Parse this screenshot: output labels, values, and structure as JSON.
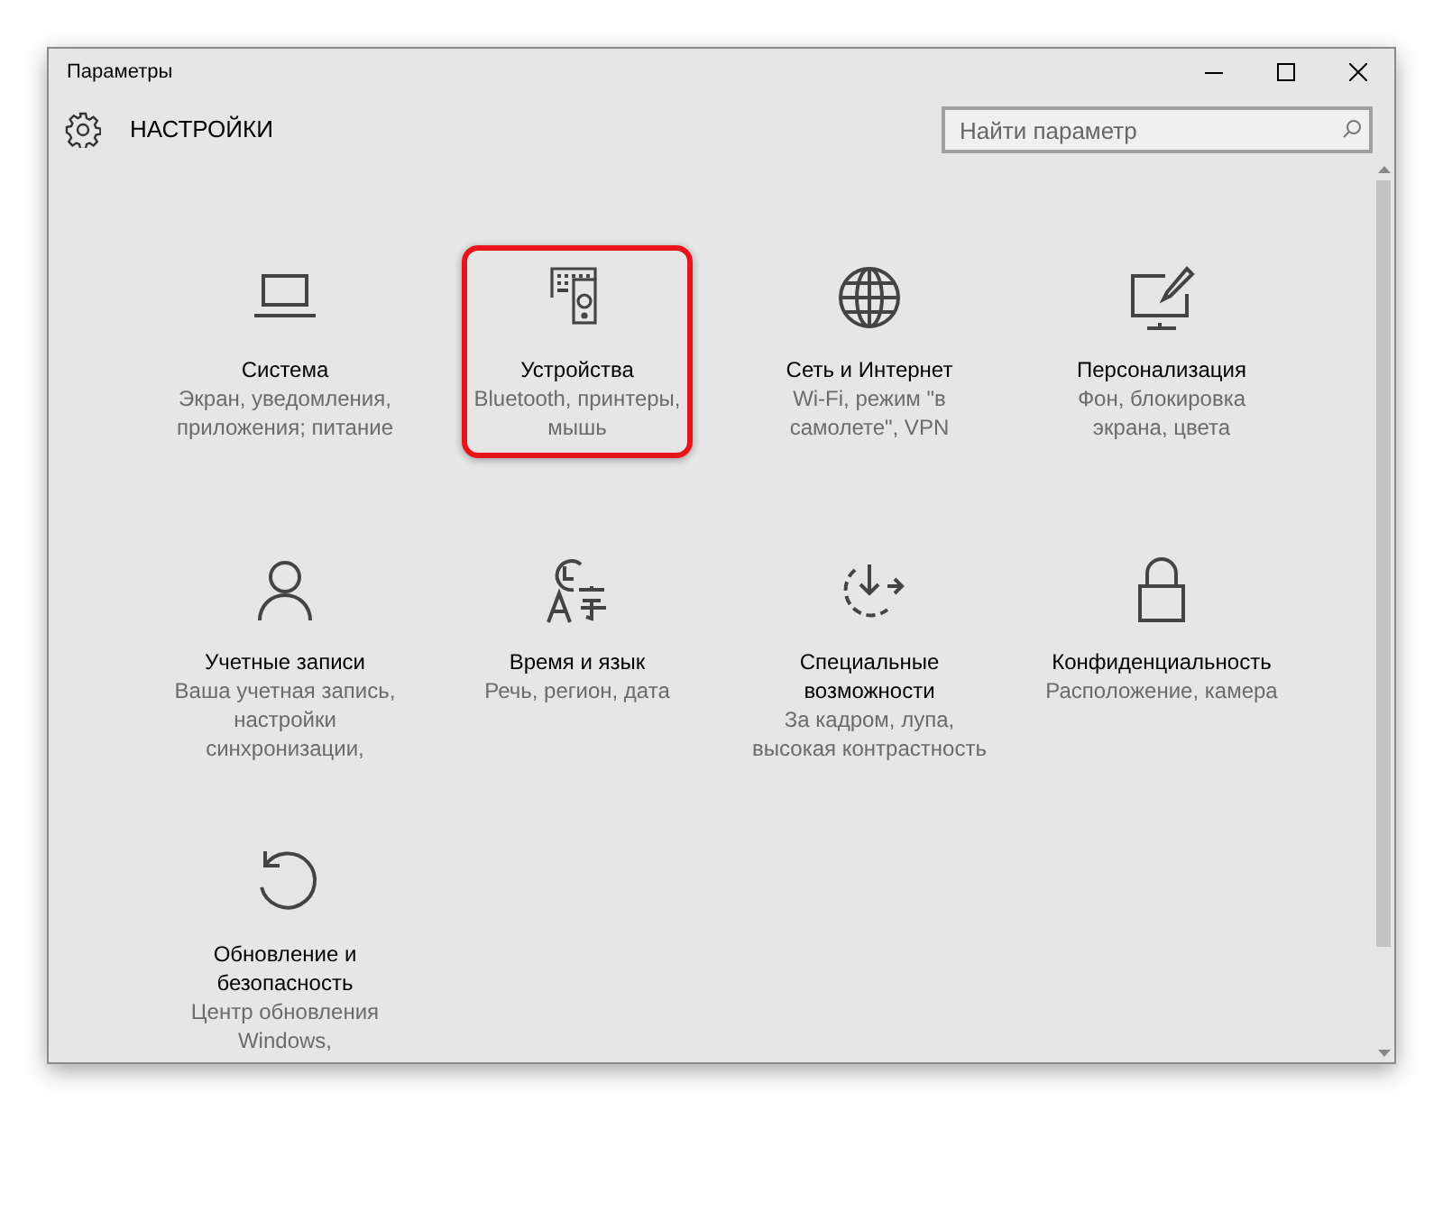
{
  "window": {
    "title": "Параметры"
  },
  "header": {
    "title": "НАСТРОЙКИ",
    "search": {
      "placeholder": "Найти параметр"
    }
  },
  "tiles": [
    {
      "title": "Система",
      "description": "Экран, уведомления,\nприложения; питание",
      "highlighted": false
    },
    {
      "title": "Устройства",
      "description": "Bluetooth, принтеры,\nмышь",
      "highlighted": true
    },
    {
      "title": "Сеть и Интернет",
      "description": "Wi-Fi, режим \"в\nсамолете\", VPN",
      "highlighted": false
    },
    {
      "title": "Персонализация",
      "description": "Фон, блокировка\nэкрана, цвета",
      "highlighted": false
    },
    {
      "title": "Учетные записи",
      "description": "Ваша учетная запись,\nнастройки\nсинхронизации,",
      "highlighted": false
    },
    {
      "title": "Время и язык",
      "description": "Речь, регион, дата",
      "highlighted": false
    },
    {
      "title": "Специальные\nвозможности",
      "description": "За кадром, лупа,\nвысокая контрастность",
      "highlighted": false
    },
    {
      "title": "Конфиденциальность",
      "description": "Расположение, камера",
      "highlighted": false
    },
    {
      "title": "Обновление и\nбезопасность",
      "description": "Центр обновления\nWindows,",
      "highlighted": false
    }
  ]
}
